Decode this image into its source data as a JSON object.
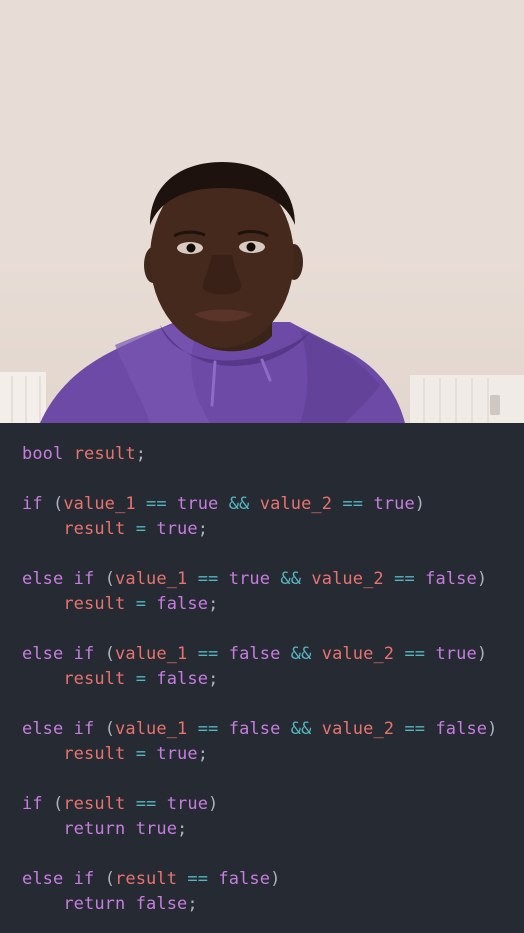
{
  "photo": {
    "subject": "person-in-purple-hoodie"
  },
  "colors": {
    "background": "#262b33",
    "keyword": "#c77de0",
    "variable": "#e8736e",
    "operator": "#56b6c2",
    "punctuation": "#abb2bf"
  },
  "code_lines": [
    [
      [
        "kw",
        "bool"
      ],
      [
        "pun",
        " "
      ],
      [
        "var",
        "result"
      ],
      [
        "pun",
        ";"
      ]
    ],
    [],
    [
      [
        "kw",
        "if"
      ],
      [
        "pun",
        " ("
      ],
      [
        "var",
        "value_1"
      ],
      [
        "op",
        " == "
      ],
      [
        "lit",
        "true"
      ],
      [
        "op",
        " && "
      ],
      [
        "var",
        "value_2"
      ],
      [
        "op",
        " == "
      ],
      [
        "lit",
        "true"
      ],
      [
        "pun",
        ")"
      ]
    ],
    [
      [
        "pun",
        "    "
      ],
      [
        "var",
        "result"
      ],
      [
        "op",
        " = "
      ],
      [
        "lit",
        "true"
      ],
      [
        "pun",
        ";"
      ]
    ],
    [],
    [
      [
        "kw",
        "else if"
      ],
      [
        "pun",
        " ("
      ],
      [
        "var",
        "value_1"
      ],
      [
        "op",
        " == "
      ],
      [
        "lit",
        "true"
      ],
      [
        "op",
        " && "
      ],
      [
        "var",
        "value_2"
      ],
      [
        "op",
        " == "
      ],
      [
        "lit",
        "false"
      ],
      [
        "pun",
        ")"
      ]
    ],
    [
      [
        "pun",
        "    "
      ],
      [
        "var",
        "result"
      ],
      [
        "op",
        " = "
      ],
      [
        "lit",
        "false"
      ],
      [
        "pun",
        ";"
      ]
    ],
    [],
    [
      [
        "kw",
        "else if"
      ],
      [
        "pun",
        " ("
      ],
      [
        "var",
        "value_1"
      ],
      [
        "op",
        " == "
      ],
      [
        "lit",
        "false"
      ],
      [
        "op",
        " && "
      ],
      [
        "var",
        "value_2"
      ],
      [
        "op",
        " == "
      ],
      [
        "lit",
        "true"
      ],
      [
        "pun",
        ")"
      ]
    ],
    [
      [
        "pun",
        "    "
      ],
      [
        "var",
        "result"
      ],
      [
        "op",
        " = "
      ],
      [
        "lit",
        "false"
      ],
      [
        "pun",
        ";"
      ]
    ],
    [],
    [
      [
        "kw",
        "else if"
      ],
      [
        "pun",
        " ("
      ],
      [
        "var",
        "value_1"
      ],
      [
        "op",
        " == "
      ],
      [
        "lit",
        "false"
      ],
      [
        "op",
        " && "
      ],
      [
        "var",
        "value_2"
      ],
      [
        "op",
        " == "
      ],
      [
        "lit",
        "false"
      ],
      [
        "pun",
        ")"
      ]
    ],
    [
      [
        "pun",
        "    "
      ],
      [
        "var",
        "result"
      ],
      [
        "op",
        " = "
      ],
      [
        "lit",
        "true"
      ],
      [
        "pun",
        ";"
      ]
    ],
    [],
    [
      [
        "kw",
        "if"
      ],
      [
        "pun",
        " ("
      ],
      [
        "var",
        "result"
      ],
      [
        "op",
        " == "
      ],
      [
        "lit",
        "true"
      ],
      [
        "pun",
        ")"
      ]
    ],
    [
      [
        "pun",
        "    "
      ],
      [
        "kw",
        "return"
      ],
      [
        "pun",
        " "
      ],
      [
        "lit",
        "true"
      ],
      [
        "pun",
        ";"
      ]
    ],
    [],
    [
      [
        "kw",
        "else if"
      ],
      [
        "pun",
        " ("
      ],
      [
        "var",
        "result"
      ],
      [
        "op",
        " == "
      ],
      [
        "lit",
        "false"
      ],
      [
        "pun",
        ")"
      ]
    ],
    [
      [
        "pun",
        "    "
      ],
      [
        "kw",
        "return"
      ],
      [
        "pun",
        " "
      ],
      [
        "lit",
        "false"
      ],
      [
        "pun",
        ";"
      ]
    ]
  ]
}
